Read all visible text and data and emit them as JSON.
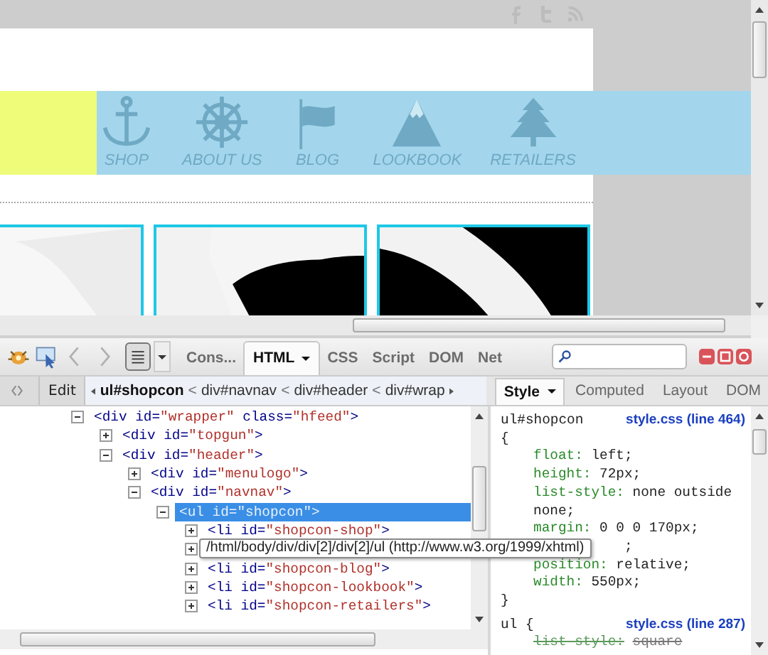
{
  "nav": [
    {
      "label": "SHOP",
      "kind": "anchor"
    },
    {
      "label": "ABOUT US",
      "kind": "wheel"
    },
    {
      "label": "BLOG",
      "kind": "flag"
    },
    {
      "label": "LOOKBOOK",
      "kind": "mountain"
    },
    {
      "label": "RETAILERS",
      "kind": "tree"
    }
  ],
  "toolbar": {
    "tabs": [
      {
        "label": "Cons...",
        "selected": false,
        "menu": false
      },
      {
        "label": "HTML",
        "selected": true,
        "menu": true
      },
      {
        "label": "CSS",
        "selected": false,
        "menu": false
      },
      {
        "label": "Script",
        "selected": false,
        "menu": false
      },
      {
        "label": "DOM",
        "selected": false,
        "menu": false
      },
      {
        "label": "Net",
        "selected": false,
        "menu": false
      }
    ]
  },
  "breadcrumb_bar": {
    "edit": "Edit",
    "path": [
      {
        "label": "ul#shopcon",
        "selected": true
      },
      {
        "separator": "<",
        "label": "div#navnav",
        "selected": false
      },
      {
        "separator": "<",
        "label": "div#header",
        "selected": false
      },
      {
        "separator": "<",
        "label": "div#wrap",
        "selected": false
      }
    ]
  },
  "side_tabs": [
    {
      "label": "Style",
      "selected": true,
      "menu": true
    },
    {
      "label": "Computed",
      "selected": false,
      "menu": false
    },
    {
      "label": "Layout",
      "selected": false,
      "menu": false
    },
    {
      "label": "DOM",
      "selected": false,
      "menu": false
    }
  ],
  "tree": [
    {
      "parts": [
        "<div id=",
        "\"wrapper\"",
        " class=",
        "\"hfeed\"",
        ">"
      ],
      "expanded": true,
      "selected": false,
      "children": [
        {
          "parts": [
            "<div id=",
            "\"topgun\"",
            ">"
          ],
          "expanded": false,
          "selected": false
        },
        {
          "parts": [
            "<div id=",
            "\"header\"",
            ">"
          ],
          "expanded": true,
          "selected": false,
          "children": [
            {
              "parts": [
                "<div id=",
                "\"menulogo\"",
                ">"
              ],
              "expanded": false,
              "selected": false
            },
            {
              "parts": [
                "<div id=",
                "\"navnav\"",
                ">"
              ],
              "expanded": true,
              "selected": false,
              "children": [
                {
                  "parts": [
                    "<ul id=",
                    "\"shopcon\"",
                    ">"
                  ],
                  "expanded": true,
                  "selected": true,
                  "children": [
                    {
                      "parts": [
                        "<li id=",
                        "\"shopcon-shop\"",
                        ">"
                      ],
                      "expanded": false,
                      "selected": false
                    },
                    {
                      "expanded": false
                    },
                    {
                      "parts": [
                        "<li id=",
                        "\"shopcon-blog\"",
                        ">"
                      ],
                      "expanded": false,
                      "selected": false
                    },
                    {
                      "parts": [
                        "<li id=",
                        "\"shopcon-lookbook\"",
                        ">"
                      ],
                      "expanded": false,
                      "selected": false
                    },
                    {
                      "parts": [
                        "<li id=",
                        "\"shopcon-retailers\"",
                        ">"
                      ],
                      "expanded": false,
                      "selected": false
                    }
                  ]
                }
              ]
            }
          ]
        }
      ]
    }
  ],
  "tooltip": "/html/body/div/div[2]/div[2]/ul (http://www.w3.org/1999/xhtml)",
  "rules": [
    {
      "selector": "ul#shopcon",
      "source": "style.css (line 464)",
      "open": "{",
      "close": "}",
      "properties": [
        {
          "name": "float:",
          "value": "left;",
          "overridden": false
        },
        {
          "name": "height:",
          "value": "72px;",
          "overridden": false
        },
        {
          "name": "list-style:",
          "value": "none outside none;",
          "overridden": false
        },
        {
          "name": "margin:",
          "value": "0 0 0 170px;",
          "overridden": false
        },
        {
          "tail": ";"
        },
        {
          "name": "position:",
          "value": "relative;",
          "overridden": false
        },
        {
          "name": "width:",
          "value": "550px;",
          "overridden": false
        }
      ]
    },
    {
      "selector": "ul {",
      "source": "style.css (line 287)",
      "properties": [
        {
          "name": "list-style:",
          "value": "square",
          "overridden": true
        }
      ]
    }
  ]
}
